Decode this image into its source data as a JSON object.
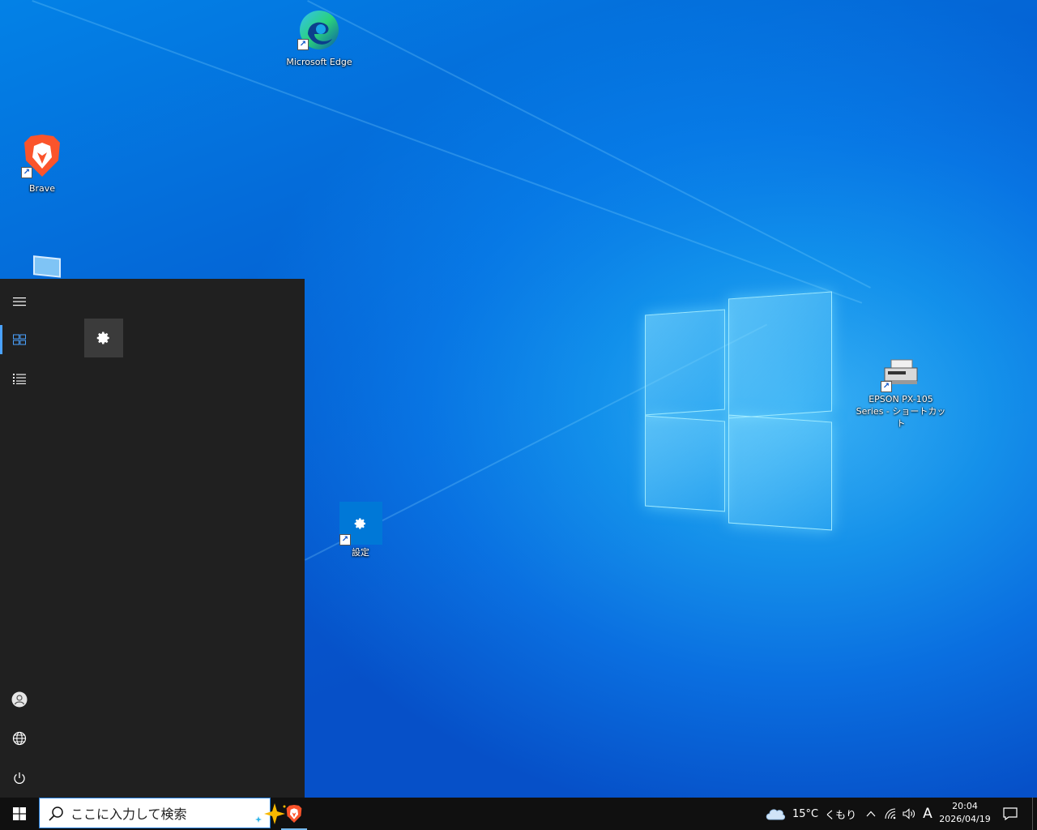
{
  "desktop": {
    "icons": {
      "edge": {
        "label": "Microsoft Edge",
        "icon": "edge-icon"
      },
      "brave": {
        "label": "Brave",
        "icon": "brave-lion-icon"
      },
      "settings": {
        "label": "設定",
        "icon": "gear-icon"
      },
      "epson_line1": "EPSON PX-105",
      "epson_line2": "Series - ショートカット"
    }
  },
  "start_menu": {
    "rail": [
      "hamburger-icon",
      "tiles-icon",
      "list-icon",
      "user-icon",
      "globe-icon",
      "power-icon"
    ],
    "pinned_tile": "gear-icon"
  },
  "taskbar": {
    "search": {
      "placeholder": "ここに入力して検索",
      "value": ""
    },
    "weather": {
      "temp": "15°C",
      "condition": "くもり"
    },
    "ime": "A",
    "clock": {
      "time": "20:04",
      "date": "2026/04/19"
    }
  },
  "colors": {
    "accent": "#0078d7",
    "start_bg": "#202020",
    "taskbar_bg": "#101010",
    "brave_orange": "#fb542b"
  }
}
